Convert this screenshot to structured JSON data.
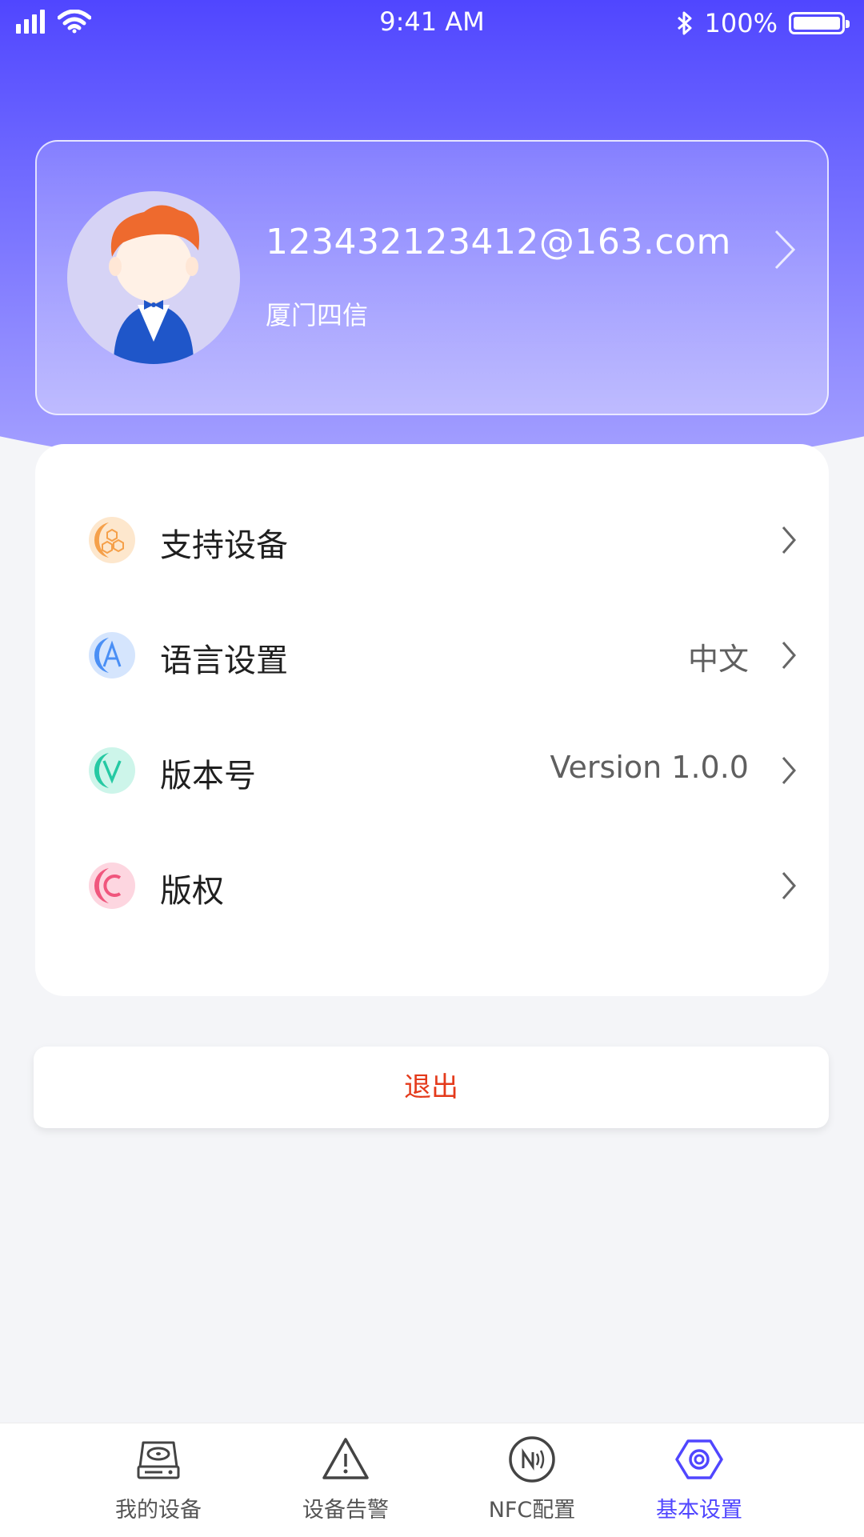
{
  "status_bar": {
    "time": "9:41 AM",
    "battery": "100%",
    "battery_level": 1.0
  },
  "profile": {
    "email": "123432123412@163.com",
    "company": "厦门四信"
  },
  "settings": {
    "items": [
      {
        "icon": "hexagon-icon",
        "label": "支持设备",
        "value": "",
        "color": "#f5a04a"
      },
      {
        "icon": "letter-a-icon",
        "label": "语言设置",
        "value": "中文",
        "color": "#4a8ff5"
      },
      {
        "icon": "letter-v-icon",
        "label": "版本号",
        "value": "Version 1.0.0",
        "color": "#25c9a3"
      },
      {
        "icon": "letter-c-icon",
        "label": "版权",
        "value": "",
        "color": "#f0567d"
      }
    ]
  },
  "logout": {
    "label": "退出"
  },
  "tabbar": {
    "tabs": [
      {
        "label": "我的设备",
        "icon": "device-icon",
        "active": false
      },
      {
        "label": "设备告警",
        "icon": "warning-icon",
        "active": false
      },
      {
        "label": "NFC配置",
        "icon": "nfc-icon",
        "active": false
      },
      {
        "label": "基本设置",
        "icon": "settings-icon",
        "active": true
      }
    ]
  },
  "colors": {
    "accent": "#5046ff",
    "logout": "#e43a1b"
  }
}
